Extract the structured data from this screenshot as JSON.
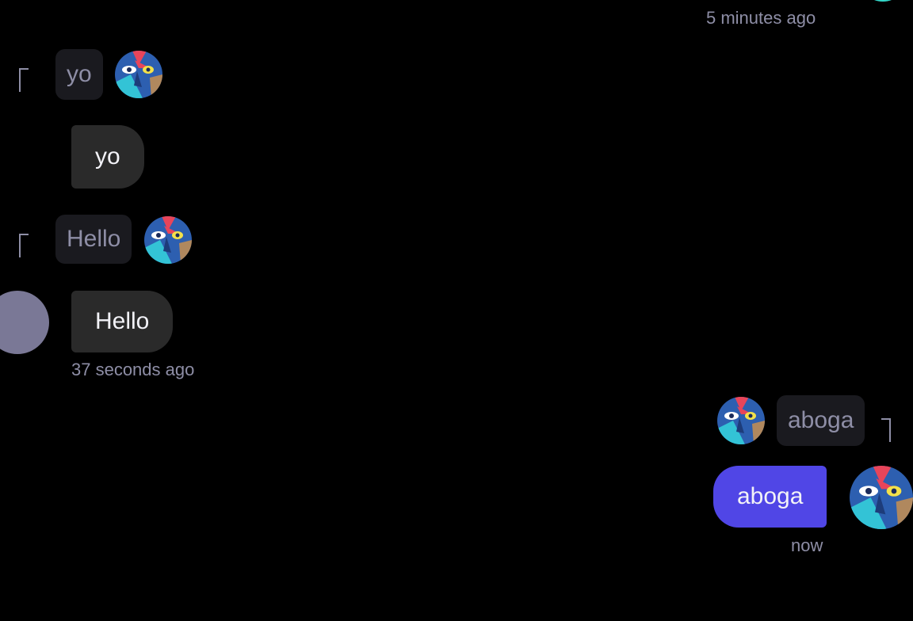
{
  "messages": {
    "top_timestamp": "5 minutes ago",
    "m1": {
      "quote": "yo",
      "text": "yo"
    },
    "m2": {
      "quote": "Hello",
      "text": "Hello",
      "timestamp": "37 seconds ago"
    },
    "m3": {
      "quote": "aboga",
      "text": "aboga",
      "timestamp": "now"
    }
  },
  "colors": {
    "background": "#000000",
    "incoming_bubble": "#2a2a2a",
    "outgoing_bubble": "#5046e6",
    "quote_bg": "#1a1a1f",
    "muted_text": "#8e8ea6"
  },
  "icons": {
    "avatar": "bird-portrait-avatar-icon",
    "placeholder_avatar": "placeholder-avatar-icon"
  }
}
